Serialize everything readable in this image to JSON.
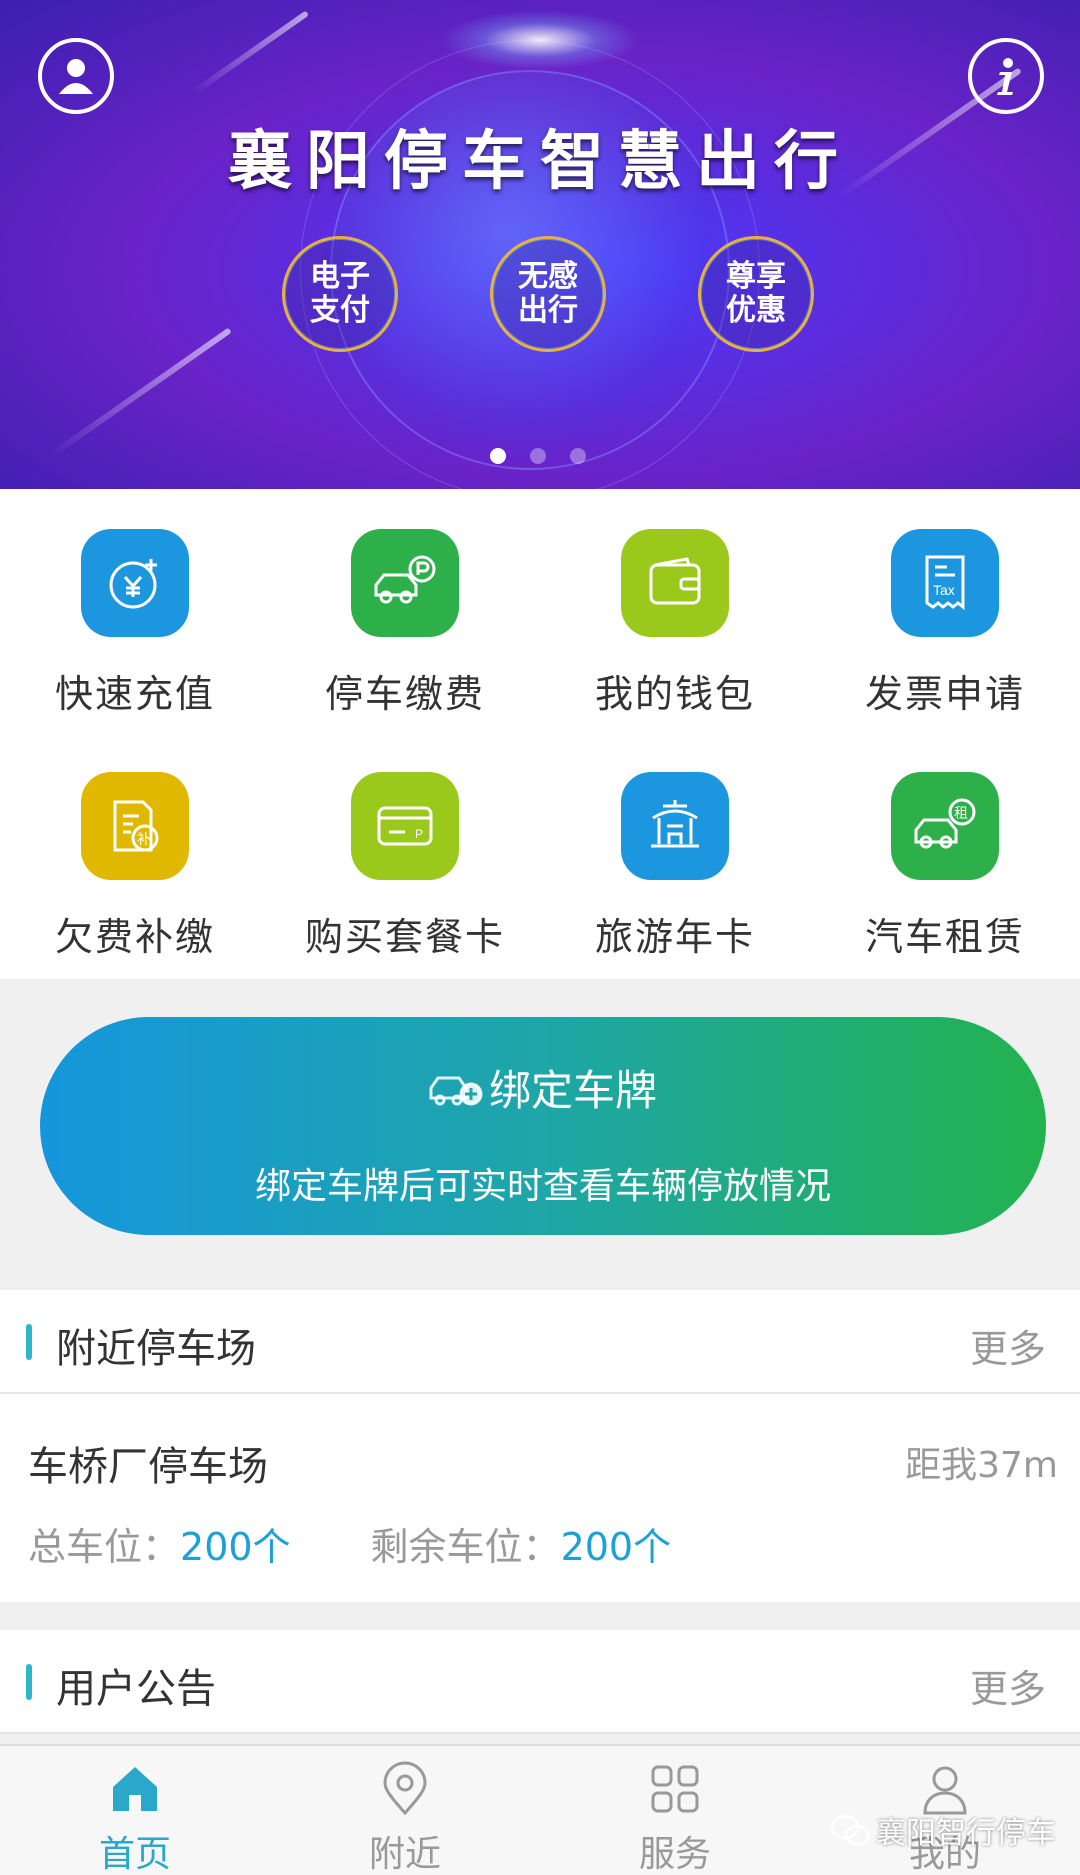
{
  "banner": {
    "title": "襄阳停车智慧出行",
    "features": [
      "电子支付",
      "无感出行",
      "尊享优惠"
    ],
    "dots": 3,
    "active_dot": 0
  },
  "menu": [
    {
      "label": "快速充值",
      "icon": "yuan-recharge-icon",
      "color": "#1d96e0"
    },
    {
      "label": "停车缴费",
      "icon": "car-parking-icon",
      "color": "#2db04a"
    },
    {
      "label": "我的钱包",
      "icon": "wallet-icon",
      "color": "#9ac91c"
    },
    {
      "label": "发票申请",
      "icon": "tax-invoice-icon",
      "color": "#1d96e0"
    },
    {
      "label": "欠费补缴",
      "icon": "arrears-icon",
      "color": "#e0b800"
    },
    {
      "label": "购买套餐卡",
      "icon": "card-icon",
      "color": "#9ac91c"
    },
    {
      "label": "旅游年卡",
      "icon": "pavilion-icon",
      "color": "#1d96e0"
    },
    {
      "label": "汽车租赁",
      "icon": "car-rental-icon",
      "color": "#2db04a"
    }
  ],
  "bind": {
    "title": "绑定车牌",
    "subtitle": "绑定车牌后可实时查看车辆停放情况"
  },
  "nearby": {
    "title": "附近停车场",
    "more": "更多",
    "lots": [
      {
        "name": "车桥厂停车场",
        "distance": "距我37m",
        "total_label": "总车位：",
        "total": "200个",
        "remain_label": "剩余车位：",
        "remain": "200个"
      }
    ]
  },
  "notice": {
    "title": "用户公告",
    "more": "更多"
  },
  "tabs": [
    {
      "label": "首页",
      "icon": "home-icon",
      "active": true
    },
    {
      "label": "附近",
      "icon": "location-pin-icon",
      "active": false
    },
    {
      "label": "服务",
      "icon": "grid-services-icon",
      "active": false
    },
    {
      "label": "我的",
      "icon": "user-icon",
      "active": false
    }
  ],
  "watermark": "襄阳智行停车",
  "colors": {
    "accent": "#2aa7c9",
    "highlight": "#1ba0d8"
  }
}
